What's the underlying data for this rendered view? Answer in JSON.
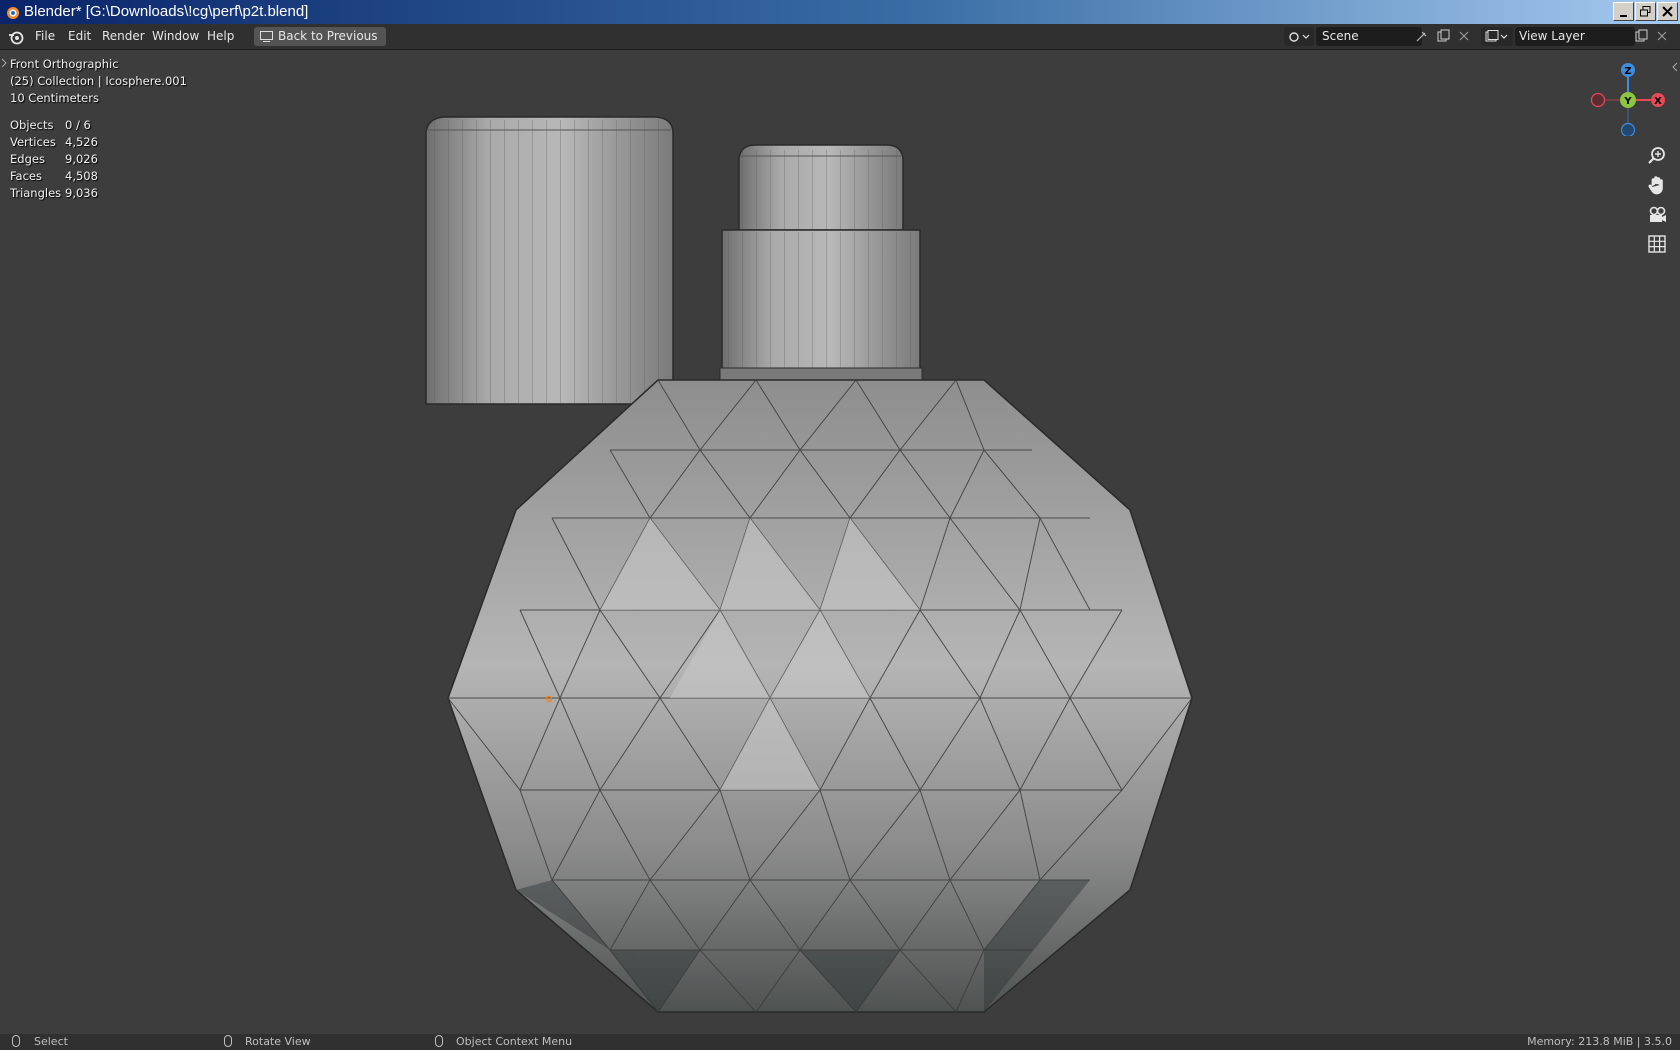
{
  "window": {
    "title": "Blender* [G:\\Downloads\\!cg\\perf\\p2t.blend]"
  },
  "menu": {
    "items": [
      "File",
      "Edit",
      "Render",
      "Window",
      "Help"
    ],
    "back_label": "Back to Previous"
  },
  "header_right": {
    "scene": "Scene",
    "view_layer": "View Layer"
  },
  "viewport": {
    "view_name": "Front Orthographic",
    "collection_info": "(25) Collection | Icosphere.001",
    "scale": "10 Centimeters",
    "stats": [
      {
        "label": "Objects",
        "value": "0 / 6"
      },
      {
        "label": "Vertices",
        "value": "4,526"
      },
      {
        "label": "Edges",
        "value": "9,026"
      },
      {
        "label": "Faces",
        "value": "4,508"
      },
      {
        "label": "Triangles",
        "value": "9,036"
      }
    ],
    "gizmo_axes": {
      "z": "Z",
      "y": "Y",
      "x": "X"
    }
  },
  "colors": {
    "axis_x": "#e84a55",
    "axis_y": "#8cc63f",
    "axis_z": "#3e8ee0",
    "viewport_bg": "#3d3d3d"
  },
  "statusbar": {
    "select": "Select",
    "rotate": "Rotate View",
    "context": "Object Context Menu",
    "memory": "Memory: 213.8 MiB | 3.5.0"
  }
}
